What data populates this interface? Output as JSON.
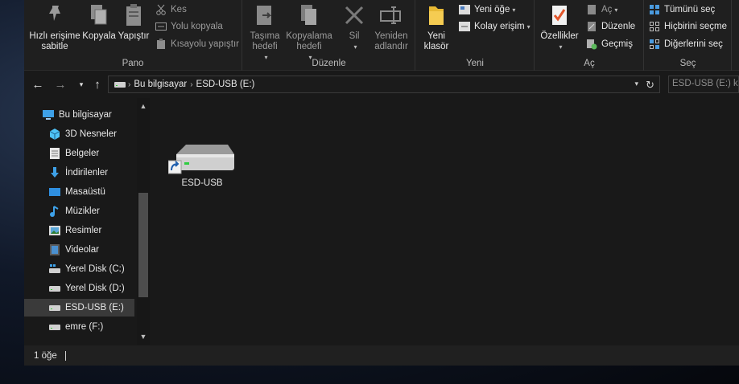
{
  "ribbon": {
    "pano": {
      "label": "Pano",
      "pin": "Hızlı erişime sabitle",
      "copy": "Kopyala",
      "paste": "Yapıştır",
      "cut": "Kes",
      "copy_path": "Yolu kopyala",
      "paste_shortcut": "Kısayolu yapıştır"
    },
    "duzenle": {
      "label": "Düzenle",
      "move_to": "Taşıma hedefi",
      "copy_to": "Kopyalama hedefi",
      "delete": "Sil",
      "rename": "Yeniden adlandır"
    },
    "yeni": {
      "label": "Yeni",
      "new_folder": "Yeni klasör",
      "new_item": "Yeni öğe",
      "easy_access": "Kolay erişim"
    },
    "ac": {
      "label": "Aç",
      "properties": "Özellikler",
      "open": "Aç",
      "edit": "Düzenle",
      "history": "Geçmiş"
    },
    "sec": {
      "label": "Seç",
      "select_all": "Tümünü seç",
      "select_none": "Hiçbirini seçme",
      "invert": "Diğerlerini seç"
    }
  },
  "address": {
    "segments": [
      "Bu bilgisayar",
      "ESD-USB (E:)"
    ],
    "search_placeholder": "ESD-USB (E:) klasörü"
  },
  "nav": {
    "items": [
      {
        "label": "Bu bilgisayar",
        "icon": "computer-icon"
      },
      {
        "label": "3D Nesneler",
        "icon": "cube-icon"
      },
      {
        "label": "Belgeler",
        "icon": "document-icon"
      },
      {
        "label": "İndirilenler",
        "icon": "download-icon"
      },
      {
        "label": "Masaüstü",
        "icon": "desktop-icon"
      },
      {
        "label": "Müzikler",
        "icon": "music-icon"
      },
      {
        "label": "Resimler",
        "icon": "picture-icon"
      },
      {
        "label": "Videolar",
        "icon": "video-icon"
      },
      {
        "label": "Yerel Disk (C:)",
        "icon": "system-drive-icon"
      },
      {
        "label": "Yerel Disk (D:)",
        "icon": "drive-icon"
      },
      {
        "label": "ESD-USB (E:)",
        "icon": "drive-icon"
      },
      {
        "label": "emre (F:)",
        "icon": "drive-icon"
      }
    ],
    "selected": "ESD-USB (E:)"
  },
  "content": {
    "items": [
      {
        "label": "ESD-USB",
        "icon": "drive-shortcut-icon"
      }
    ]
  },
  "status": {
    "count": "1 öğe"
  }
}
